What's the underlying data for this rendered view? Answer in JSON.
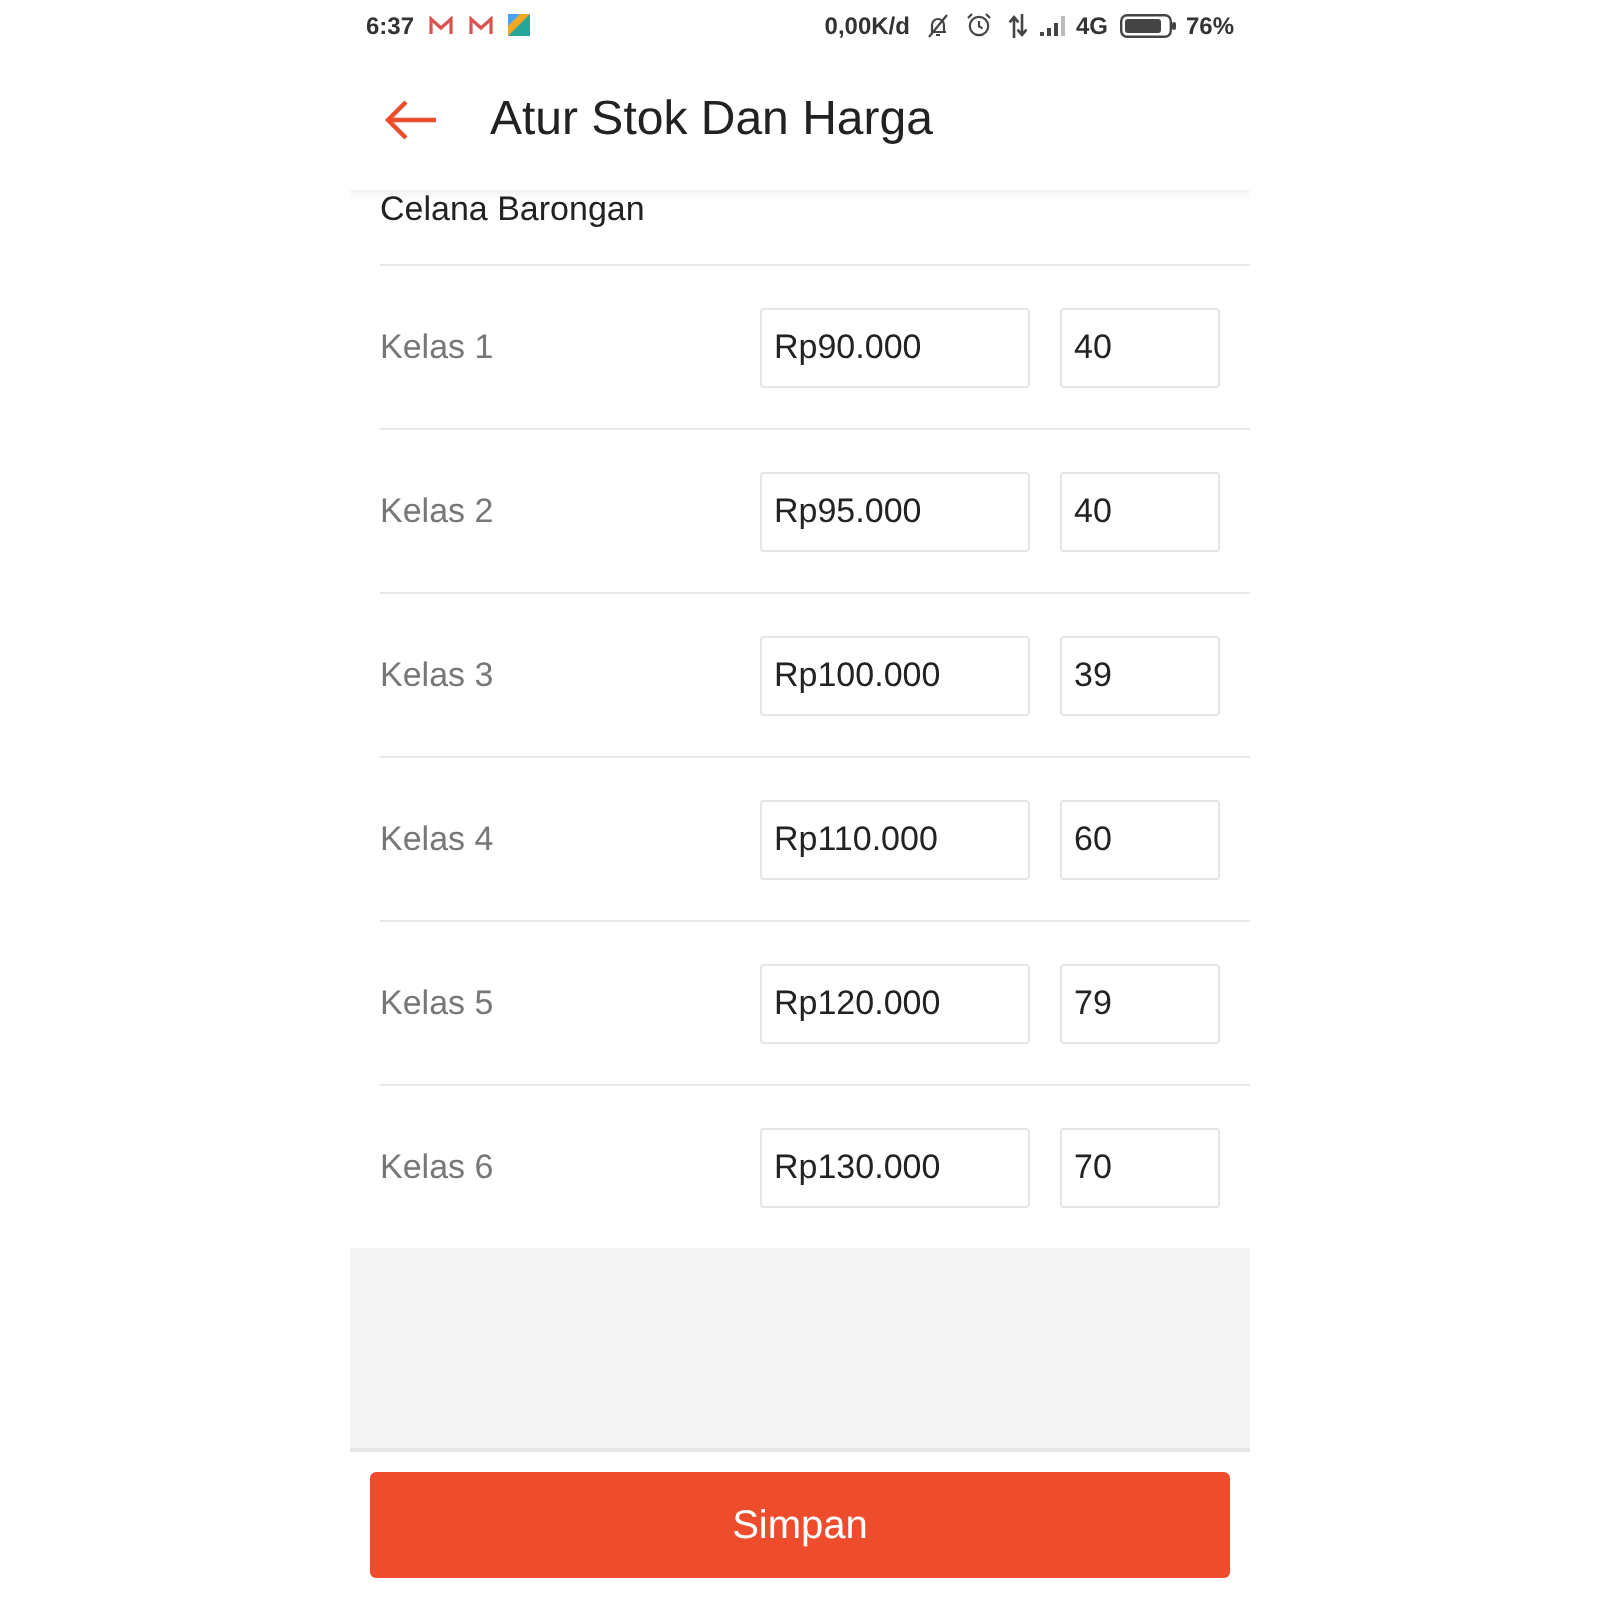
{
  "status_bar": {
    "time": "6:37",
    "network_speed": "0,00K/d",
    "network_type": "4G",
    "battery": "76%"
  },
  "app_bar": {
    "title": "Atur Stok Dan Harga"
  },
  "product_name": "Celana Barongan",
  "variants": [
    {
      "name": "Kelas 1",
      "price": "Rp90.000",
      "stock": "40"
    },
    {
      "name": "Kelas 2",
      "price": "Rp95.000",
      "stock": "40"
    },
    {
      "name": "Kelas 3",
      "price": "Rp100.000",
      "stock": "39"
    },
    {
      "name": "Kelas 4",
      "price": "Rp110.000",
      "stock": "60"
    },
    {
      "name": "Kelas 5",
      "price": "Rp120.000",
      "stock": "79"
    },
    {
      "name": "Kelas 6",
      "price": "Rp130.000",
      "stock": "70"
    }
  ],
  "save_button": {
    "label": "Simpan"
  }
}
